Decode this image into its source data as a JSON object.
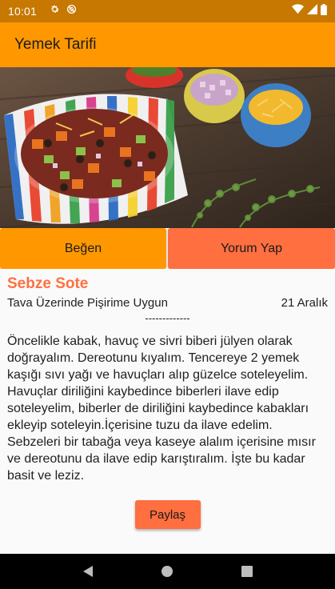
{
  "status_bar": {
    "time": "10:01",
    "icons_left": [
      "gear-icon",
      "do-not-disturb-icon"
    ],
    "icons_right": [
      "wifi-icon",
      "signal-icon",
      "battery-icon"
    ]
  },
  "app_bar": {
    "title": "Yemek Tarifi",
    "color": "#ff9800"
  },
  "hero_image": {
    "subject": "vegetable-salad-bowl"
  },
  "actions": {
    "like_label": "Beğen",
    "comment_label": "Yorum Yap",
    "like_color": "#ff9800",
    "comment_color": "#ff6f40"
  },
  "recipe": {
    "title": "Sebze Sote",
    "subtitle": "Tava Üzerinde Pişirime Uygun",
    "date": "21 Aralık",
    "divider": "-------------",
    "description": "Öncelikle kabak, havuç ve sivri biberi jülyen olarak doğrayalım. Dereotunu kıyalım. Tencereye 2 yemek kaşığı sıvı yağı ve havuçları alıp güzelce soteleyelim. Havuçlar diriliğini kaybedince biberleri ilave edip soteleyelim, biberler de diriliğini kaybedince kabakları ekleyip soteleyin.İçerisine tuzu da ilave edelim. Sebzeleri bir tabağa veya kaseye alalım içerisine mısır ve dereotunu da ilave edip karıştıralım. İşte bu kadar basit ve leziz.",
    "title_color": "#ff6f40"
  },
  "share": {
    "label": "Paylaş"
  },
  "nav_bar": {
    "buttons": [
      "back-icon",
      "home-icon",
      "recents-icon"
    ]
  }
}
